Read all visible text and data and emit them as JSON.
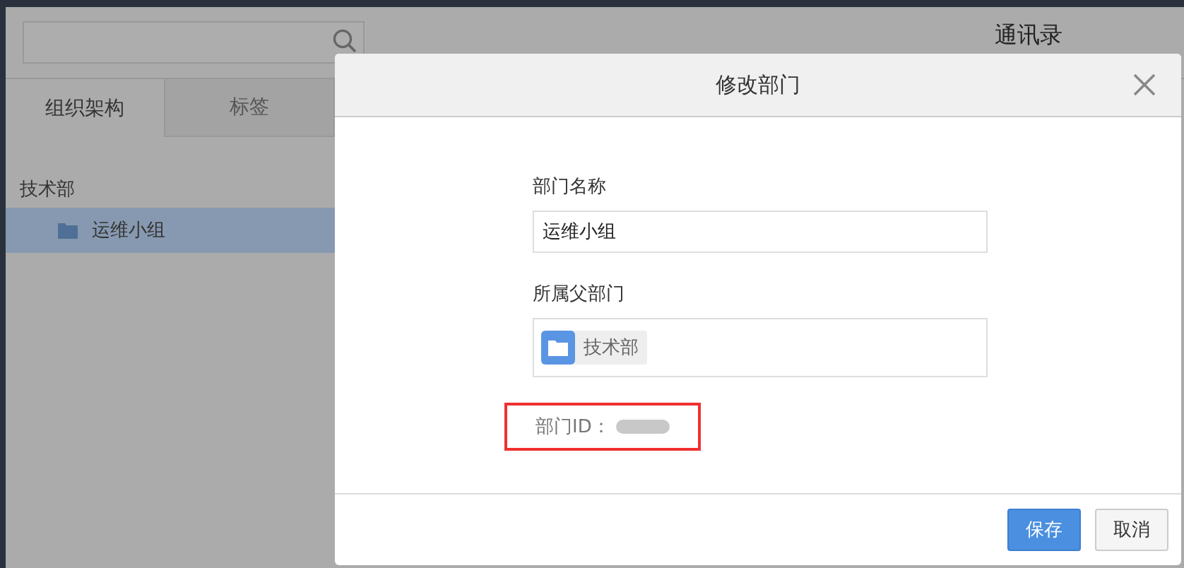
{
  "page_title": "通讯录",
  "tabs": [
    {
      "label": "组织架构",
      "selected": true
    },
    {
      "label": "标签",
      "selected": false
    }
  ],
  "tree": [
    {
      "label": "技术部",
      "selected": false,
      "children": [
        {
          "label": "运维小组",
          "selected": true
        }
      ]
    }
  ],
  "dialog": {
    "title": "修改部门",
    "fields": [
      {
        "kind": "text",
        "label": "部门名称",
        "value": "运维小组"
      },
      {
        "kind": "tags",
        "label": "所属父部门",
        "tags": [
          "技术部"
        ]
      }
    ],
    "id_label": "部门ID：",
    "id_highlighted": true,
    "buttons": [
      {
        "label": "保存",
        "primary": true
      },
      {
        "label": "取消",
        "primary": false
      }
    ]
  }
}
